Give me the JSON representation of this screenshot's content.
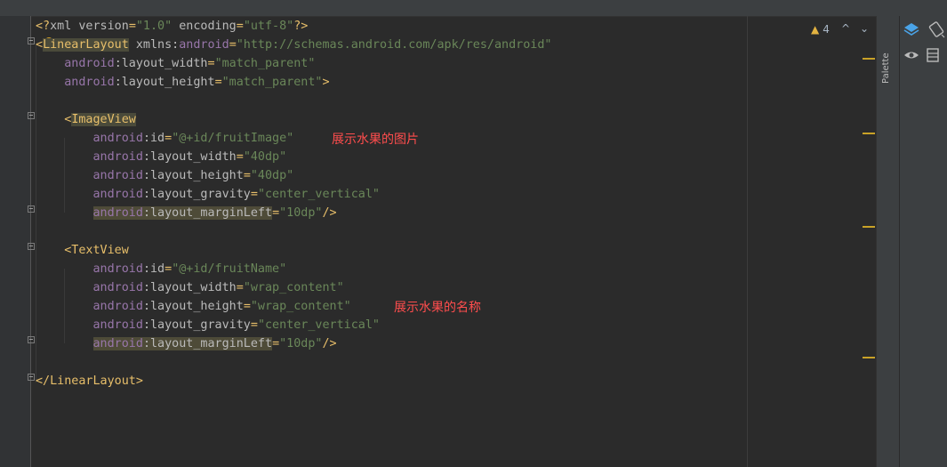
{
  "editor": {
    "lines": [
      {
        "parts": [
          [
            "punct",
            "<?"
          ],
          [
            "attr",
            "xml "
          ],
          [
            "attr",
            "version"
          ],
          [
            "punct",
            "="
          ],
          [
            "val",
            "\"1.0\""
          ],
          [
            "attr",
            " encoding"
          ],
          [
            "punct",
            "="
          ],
          [
            "val",
            "\"utf-8\""
          ],
          [
            "punct",
            "?>"
          ]
        ]
      },
      {
        "parts": [
          [
            "tag",
            "<"
          ],
          [
            "tagbg",
            "LinearLayout"
          ],
          [
            "attr",
            " xmlns:"
          ],
          [
            "attrns",
            "android"
          ],
          [
            "punct",
            "="
          ],
          [
            "val",
            "\"http://schemas.android.com/apk/res/android\""
          ]
        ]
      },
      {
        "parts": [
          [
            "attr",
            "    "
          ],
          [
            "attrns",
            "android"
          ],
          [
            "attr",
            ":layout_width"
          ],
          [
            "punct",
            "="
          ],
          [
            "val",
            "\"match_parent\""
          ]
        ]
      },
      {
        "parts": [
          [
            "attr",
            "    "
          ],
          [
            "attrns",
            "android"
          ],
          [
            "attr",
            ":layout_height"
          ],
          [
            "punct",
            "="
          ],
          [
            "val",
            "\"match_parent\""
          ],
          [
            "tag",
            ">"
          ]
        ]
      },
      {
        "parts": []
      },
      {
        "parts": [
          [
            "attr",
            "    "
          ],
          [
            "tag",
            "<"
          ],
          [
            "tagbg",
            "ImageView"
          ]
        ]
      },
      {
        "parts": [
          [
            "attr",
            "        "
          ],
          [
            "attrns",
            "android"
          ],
          [
            "attr",
            ":id"
          ],
          [
            "punct",
            "="
          ],
          [
            "val",
            "\"@+id/fruitImage\""
          ]
        ]
      },
      {
        "parts": [
          [
            "attr",
            "        "
          ],
          [
            "attrns",
            "android"
          ],
          [
            "attr",
            ":layout_width"
          ],
          [
            "punct",
            "="
          ],
          [
            "val",
            "\"40dp\""
          ]
        ]
      },
      {
        "parts": [
          [
            "attr",
            "        "
          ],
          [
            "attrns",
            "android"
          ],
          [
            "attr",
            ":layout_height"
          ],
          [
            "punct",
            "="
          ],
          [
            "val",
            "\"40dp\""
          ]
        ]
      },
      {
        "parts": [
          [
            "attr",
            "        "
          ],
          [
            "attrns",
            "android"
          ],
          [
            "attr",
            ":layout_gravity"
          ],
          [
            "punct",
            "="
          ],
          [
            "val",
            "\"center_vertical\""
          ]
        ]
      },
      {
        "parts": [
          [
            "attr",
            "        "
          ],
          [
            "hlns",
            "android"
          ],
          [
            "hl",
            ":layout_marginLeft"
          ],
          [
            "punct",
            "="
          ],
          [
            "val",
            "\"10dp\""
          ],
          [
            "tag",
            "/>"
          ]
        ]
      },
      {
        "parts": []
      },
      {
        "parts": [
          [
            "attr",
            "    "
          ],
          [
            "tag",
            "<TextView"
          ]
        ]
      },
      {
        "parts": [
          [
            "attr",
            "        "
          ],
          [
            "attrns",
            "android"
          ],
          [
            "attr",
            ":id"
          ],
          [
            "punct",
            "="
          ],
          [
            "val",
            "\"@+id/fruitName\""
          ]
        ]
      },
      {
        "parts": [
          [
            "attr",
            "        "
          ],
          [
            "attrns",
            "android"
          ],
          [
            "attr",
            ":layout_width"
          ],
          [
            "punct",
            "="
          ],
          [
            "val",
            "\"wrap_content\""
          ]
        ]
      },
      {
        "parts": [
          [
            "attr",
            "        "
          ],
          [
            "attrns",
            "android"
          ],
          [
            "attr",
            ":layout_height"
          ],
          [
            "punct",
            "="
          ],
          [
            "val",
            "\"wrap_content\""
          ]
        ]
      },
      {
        "parts": [
          [
            "attr",
            "        "
          ],
          [
            "attrns",
            "android"
          ],
          [
            "attr",
            ":layout_gravity"
          ],
          [
            "punct",
            "="
          ],
          [
            "val",
            "\"center_vertical\""
          ]
        ]
      },
      {
        "parts": [
          [
            "attr",
            "        "
          ],
          [
            "hlns",
            "android"
          ],
          [
            "hl",
            ":layout_marginLeft"
          ],
          [
            "punct",
            "="
          ],
          [
            "val",
            "\"10dp\""
          ],
          [
            "tag",
            "/>"
          ]
        ]
      },
      {
        "parts": []
      },
      {
        "parts": [
          [
            "tag",
            "</LinearLayout>"
          ]
        ]
      }
    ]
  },
  "annotations": {
    "image_note": "展示水果的图片",
    "name_note": "展示水果的名称"
  },
  "inspections": {
    "warning_count": "4"
  },
  "side_panel": {
    "palette_label": "Palette"
  },
  "icons": {
    "warning": "warning-triangle-icon",
    "prev": "chevron-up-icon",
    "next": "chevron-down-icon",
    "layers": "layers-icon",
    "rotate": "rotate-orientation-icon",
    "eye": "eye-icon",
    "blueprint": "blueprint-icon"
  },
  "colors": {
    "background": "#2b2b2b",
    "tag": "#e8bf6a",
    "namespace": "#9876aa",
    "value": "#6a8759",
    "annotation": "#ff4d4d",
    "warning": "#e3b341"
  }
}
